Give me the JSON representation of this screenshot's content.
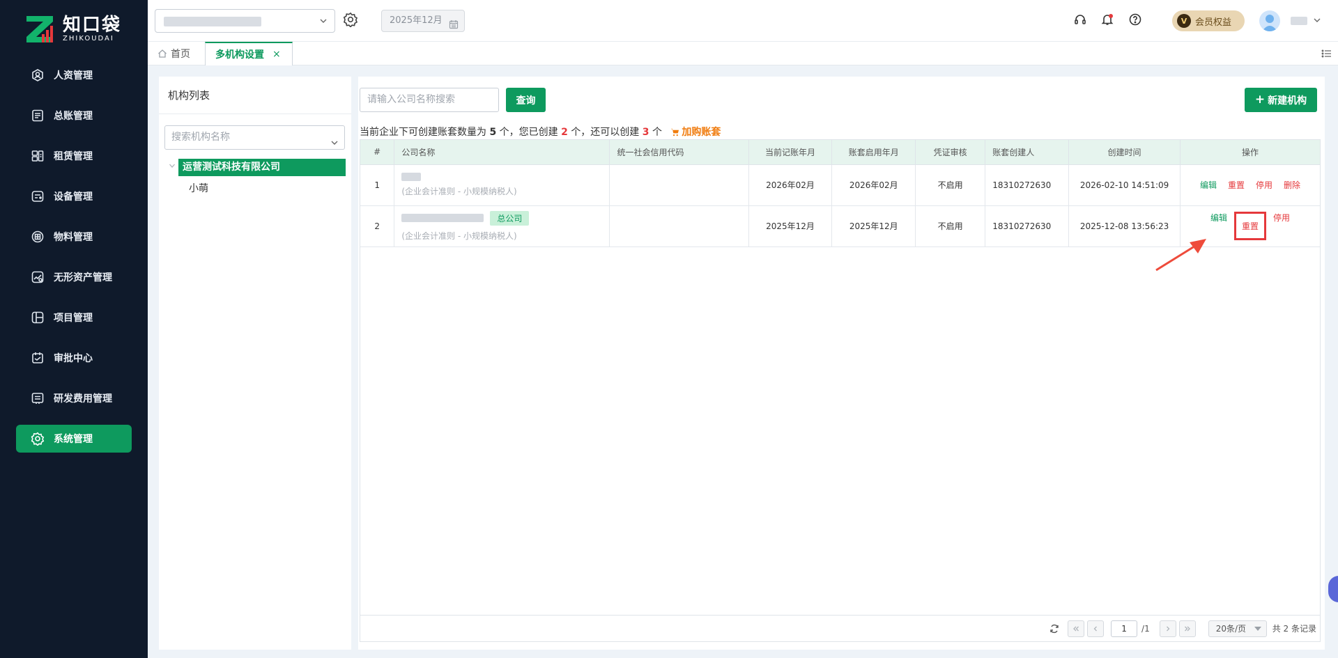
{
  "app": {
    "logo_cn": "知口袋",
    "logo_en": "ZHIKOUDAI"
  },
  "sidebar": {
    "items": [
      {
        "label": "人资管理",
        "icon": "user-circle-icon"
      },
      {
        "label": "总账管理",
        "icon": "ledger-icon"
      },
      {
        "label": "租赁管理",
        "icon": "lease-icon"
      },
      {
        "label": "设备管理",
        "icon": "device-icon"
      },
      {
        "label": "物料管理",
        "icon": "material-icon"
      },
      {
        "label": "无形资产管理",
        "icon": "intangible-asset-icon"
      },
      {
        "label": "项目管理",
        "icon": "project-icon"
      },
      {
        "label": "审批中心",
        "icon": "approval-icon"
      },
      {
        "label": "研发费用管理",
        "icon": "rd-expense-icon"
      },
      {
        "label": "系统管理",
        "icon": "gear-icon",
        "active": true
      }
    ]
  },
  "header": {
    "period": "2025年12月",
    "vip_label": "会员权益",
    "vip_badge": "V"
  },
  "tabs": [
    {
      "label": "首页"
    },
    {
      "label": "多机构设置",
      "active": true,
      "close": "×"
    }
  ],
  "org_panel": {
    "title": "机构列表",
    "search_placeholder": "搜索机构名称",
    "root": "运营测试科技有限公司",
    "child": "小萌"
  },
  "main": {
    "search_placeholder": "请输入公司名称搜索",
    "query_label": "查询",
    "new_label": "新建机构",
    "info": {
      "prefix": "当前企业下可创建账套数量为",
      "max": "5",
      "unit1": "个，您已创建",
      "created": "2",
      "unit2": "个，还可以创建",
      "remaining": "3",
      "unit3": "个",
      "buy_label": "加购账套"
    }
  },
  "table": {
    "headers": [
      "#",
      "公司名称",
      "统一社会信用代码",
      "当前记账年月",
      "账套启用年月",
      "凭证审核",
      "账套创建人",
      "创建时间",
      "操作"
    ],
    "rows": [
      {
        "index": "1",
        "sub": "(企业会计准则 - 小规模纳税人)",
        "credit_code": "",
        "current_period": "2026年02月",
        "start_period": "2026年02月",
        "audit": "不启用",
        "creator": "18310272630",
        "created_at": "2026-02-10 14:51:09",
        "ops": [
          "编辑",
          "重置",
          "停用",
          "删除"
        ]
      },
      {
        "index": "2",
        "tag": "总公司",
        "sub": "(企业会计准则 - 小规模纳税人)",
        "credit_code": "",
        "current_period": "2025年12月",
        "start_period": "2025年12月",
        "audit": "不启用",
        "creator": "18310272630",
        "created_at": "2025-12-08 13:56:23",
        "ops": [
          "编辑",
          "重置",
          "停用"
        ]
      }
    ]
  },
  "pager": {
    "page": "1",
    "total_pages": "/1",
    "page_size": "20条/页",
    "total": "共 2 条记录"
  },
  "colors": {
    "brand": "#0e9a5e",
    "sidebar_bg": "#0f1a2b",
    "danger": "#e5383b",
    "accent_orange": "#f07c0f"
  }
}
